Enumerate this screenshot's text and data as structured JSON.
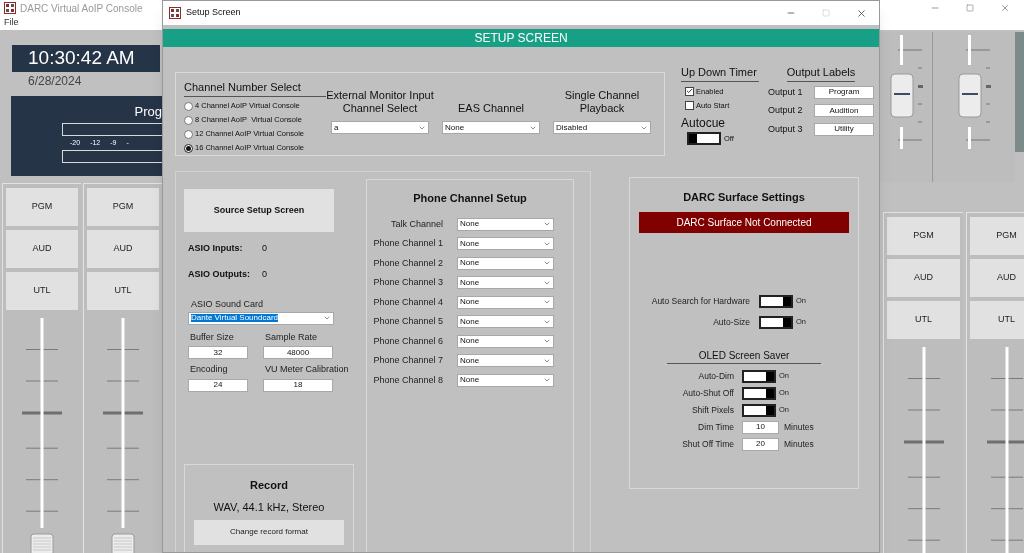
{
  "app": {
    "title": "DARC Virtual AoIP Console",
    "menu": [
      "File"
    ]
  },
  "clock": {
    "time": "10:30:42 AM",
    "date": "6/28/2024"
  },
  "meter": {
    "title": "Prog",
    "scale": [
      "-20",
      "-12",
      "-9",
      "-"
    ]
  },
  "left_strips": [
    {
      "buttons": [
        "PGM",
        "AUD",
        "UTL"
      ]
    },
    {
      "buttons": [
        "PGM",
        "AUD",
        "UTL"
      ]
    }
  ],
  "right_strips": [
    {
      "buttons": [
        "PGM",
        "AUD",
        "UTL"
      ]
    },
    {
      "buttons": [
        "PGM",
        "AUD",
        "UTL"
      ]
    }
  ],
  "dialog": {
    "title": "Setup Screen",
    "header": "SETUP SCREEN",
    "channel_select": {
      "title": "Channel Number Select",
      "options": [
        {
          "label": "4 Channel AoIP Virtual Console",
          "selected": false
        },
        {
          "label": "8 Channel AoIP  Virtual Console",
          "selected": false
        },
        {
          "label": "12 Channel AoIP Virtual Console",
          "selected": false
        },
        {
          "label": "16 Channel AoIP Virtual Console",
          "selected": true
        }
      ]
    },
    "dropdowns": [
      {
        "label": "External Monitor Input Channel Select",
        "value": "a"
      },
      {
        "label": "EAS Channel",
        "value": "None"
      },
      {
        "label": "Single Channel Playback",
        "value": "Disabled"
      }
    ],
    "timer": {
      "title": "Up Down Timer",
      "options": [
        {
          "label": "Enabled",
          "checked": true
        },
        {
          "label": "Auto Start",
          "checked": false
        }
      ]
    },
    "autocue": {
      "title": "Autocue",
      "on": false,
      "state_label": "Off"
    },
    "output_labels": {
      "title": "Output Labels",
      "rows": [
        {
          "label": "Output 1",
          "value": "Program"
        },
        {
          "label": "Output 2",
          "value": "Audition"
        },
        {
          "label": "Output 3",
          "value": "Utility"
        }
      ]
    },
    "source_button": "Source Setup Screen",
    "asio_stats": [
      {
        "label": "ASIO Inputs:",
        "value": "0"
      },
      {
        "label": "ASIO Outputs:",
        "value": "0"
      }
    ],
    "sound_card": {
      "label": "ASIO Sound Card",
      "value": "Dante Virtual Soundcard"
    },
    "fields": [
      {
        "label": "Buffer Size",
        "value": "32"
      },
      {
        "label": "Sample Rate",
        "value": "48000"
      },
      {
        "label": "Encoding",
        "value": "24"
      },
      {
        "label": "VU Meter Calibration",
        "value": "18"
      }
    ],
    "record": {
      "title": "Record",
      "format": "WAV, 44.1 kHz, Stereo",
      "button": "Change record format"
    },
    "phone": {
      "title": "Phone Channel Setup",
      "rows": [
        {
          "label": "Talk Channel",
          "value": "None"
        },
        {
          "label": "Phone Channel 1",
          "value": "None"
        },
        {
          "label": "Phone Channel 2",
          "value": "None"
        },
        {
          "label": "Phone Channel 3",
          "value": "None"
        },
        {
          "label": "Phone Channel 4",
          "value": "None"
        },
        {
          "label": "Phone Channel 5",
          "value": "None"
        },
        {
          "label": "Phone Channel 6",
          "value": "None"
        },
        {
          "label": "Phone Channel 7",
          "value": "None"
        },
        {
          "label": "Phone Channel 8",
          "value": "None"
        }
      ]
    },
    "surface": {
      "title": "DARC Surface Settings",
      "status": "DARC Surface Not Connected",
      "toggles": [
        {
          "label": "Auto Search for Hardware",
          "on": true,
          "state_label": "On"
        },
        {
          "label": "Auto-Size",
          "on": true,
          "state_label": "On"
        }
      ],
      "oled": {
        "title": "OLED Screen Saver",
        "toggles": [
          {
            "label": "Auto-Dim",
            "on": true,
            "state_label": "On"
          },
          {
            "label": "Auto-Shut Off",
            "on": true,
            "state_label": "On"
          },
          {
            "label": "Shift Pixels",
            "on": true,
            "state_label": "On"
          }
        ],
        "times": [
          {
            "label": "Dim Time",
            "value": "10",
            "unit": "Minutes"
          },
          {
            "label": "Shut Off Time",
            "value": "20",
            "unit": "Minutes"
          }
        ]
      }
    }
  }
}
